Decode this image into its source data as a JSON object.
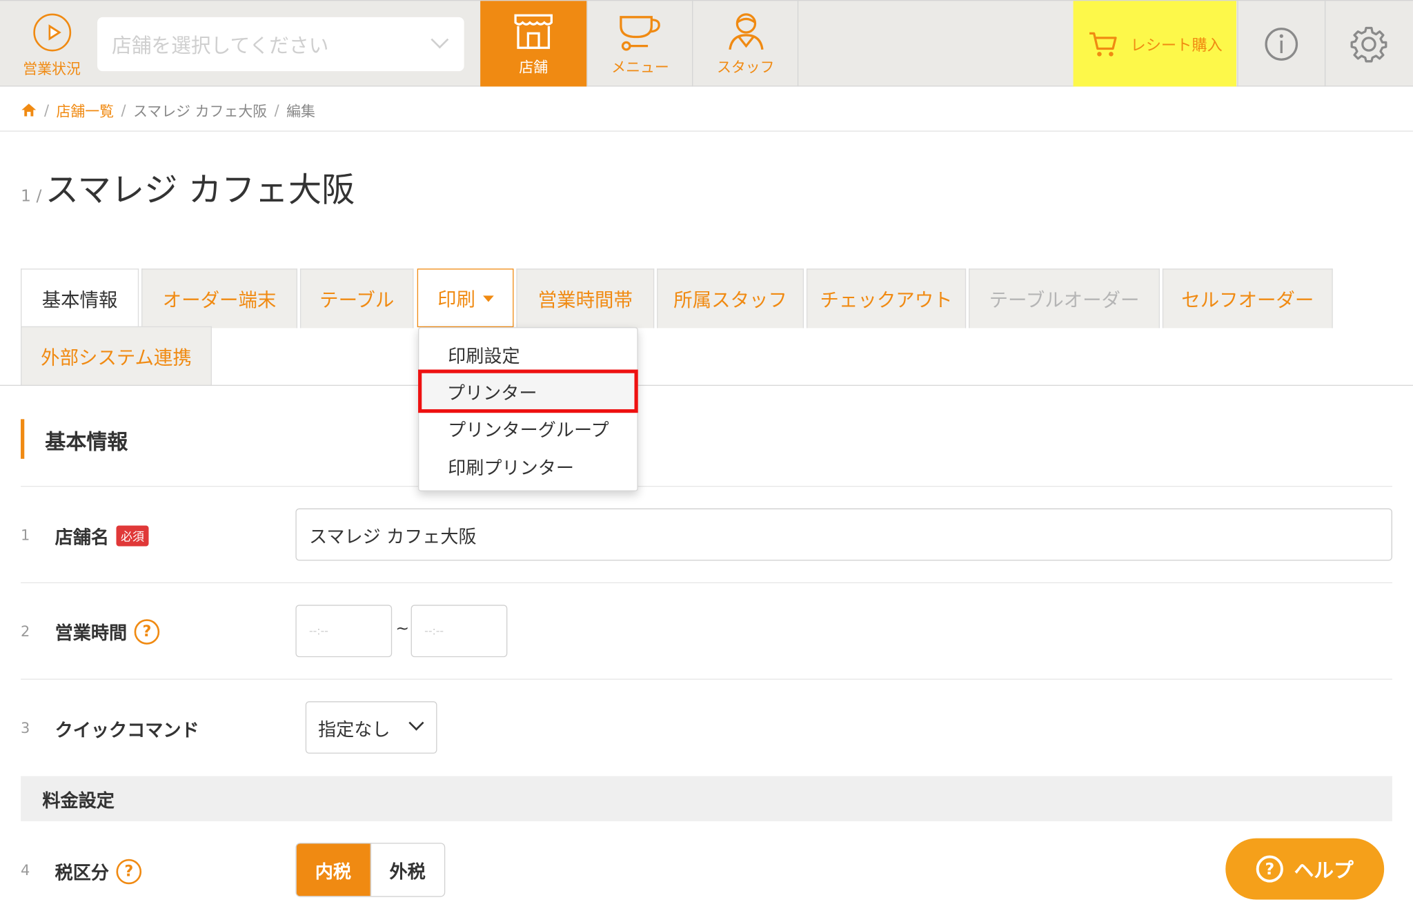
{
  "header": {
    "status_label": "営業状況",
    "store_select_placeholder": "店舗を選択してください",
    "nav": [
      {
        "label": "店舗",
        "icon": "store-icon",
        "active": true
      },
      {
        "label": "メニュー",
        "icon": "cup-icon",
        "active": false
      },
      {
        "label": "スタッフ",
        "icon": "staff-icon",
        "active": false
      }
    ],
    "receipt_label": "レシート購入",
    "info_icon": "info-icon",
    "settings_icon": "gear-icon"
  },
  "breadcrumb": {
    "home_icon": "home-icon",
    "items": [
      "店舗一覧",
      "スマレジ カフェ大阪",
      "編集"
    ]
  },
  "page": {
    "number": "1 /",
    "title": "スマレジ カフェ大阪"
  },
  "tabs": [
    {
      "label": "基本情報",
      "state": "active"
    },
    {
      "label": "オーダー端末",
      "state": "normal"
    },
    {
      "label": "テーブル",
      "state": "normal"
    },
    {
      "label": "印刷",
      "state": "open"
    },
    {
      "label": "営業時間帯",
      "state": "normal"
    },
    {
      "label": "所属スタッフ",
      "state": "normal"
    },
    {
      "label": "チェックアウト",
      "state": "normal"
    },
    {
      "label": "テーブルオーダー",
      "state": "disabled"
    },
    {
      "label": "セルフオーダー",
      "state": "normal"
    },
    {
      "label": "外部システム連携",
      "state": "normal"
    }
  ],
  "print_menu": {
    "items": [
      "印刷設定",
      "プリンター",
      "プリンターグループ",
      "印刷プリンター"
    ],
    "highlighted": "プリンター"
  },
  "section": {
    "title": "基本情報",
    "rows": [
      {
        "num": "1",
        "label": "店舗名",
        "required_badge": "必須",
        "value": "スマレジ カフェ大阪"
      },
      {
        "num": "2",
        "label": "営業時間",
        "start_placeholder": "--:--",
        "separator": "~",
        "end_placeholder": "--:--"
      },
      {
        "num": "3",
        "label": "クイックコマンド",
        "value": "指定なし"
      }
    ],
    "subsection": "料金設定",
    "tax_row": {
      "num": "4",
      "label": "税区分",
      "options": [
        "内税",
        "外税"
      ],
      "selected": "内税"
    }
  },
  "help": {
    "label": "ヘルプ"
  },
  "colors": {
    "accent": "#f08a12",
    "receipt_bg": "#fdf84a",
    "highlight_border": "#ee1111",
    "required_badge": "#e03838"
  }
}
